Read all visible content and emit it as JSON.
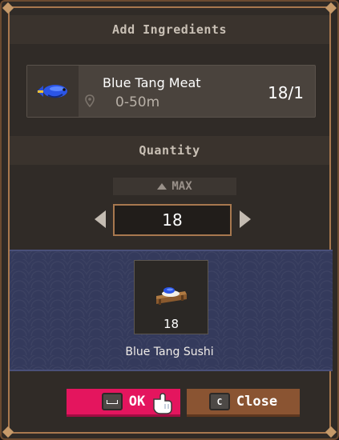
{
  "dialog": {
    "title": "Add Ingredients",
    "quantity_header": "Quantity"
  },
  "ingredient": {
    "name": "Blue Tang Meat",
    "depth": "0-50m",
    "count": "18/1",
    "icon": "blue-tang-fish-icon"
  },
  "quantity": {
    "max_label": "MAX",
    "value": "18"
  },
  "result": {
    "name": "Blue Tang Sushi",
    "count": "18",
    "icon": "blue-tang-sushi-icon"
  },
  "buttons": {
    "ok_label": "OK",
    "close_label": "Close",
    "close_key": "C"
  },
  "colors": {
    "ok_button": "#e4155e",
    "close_button": "#8a5432",
    "frame": "#a8784f",
    "result_band": "#343a5c"
  }
}
